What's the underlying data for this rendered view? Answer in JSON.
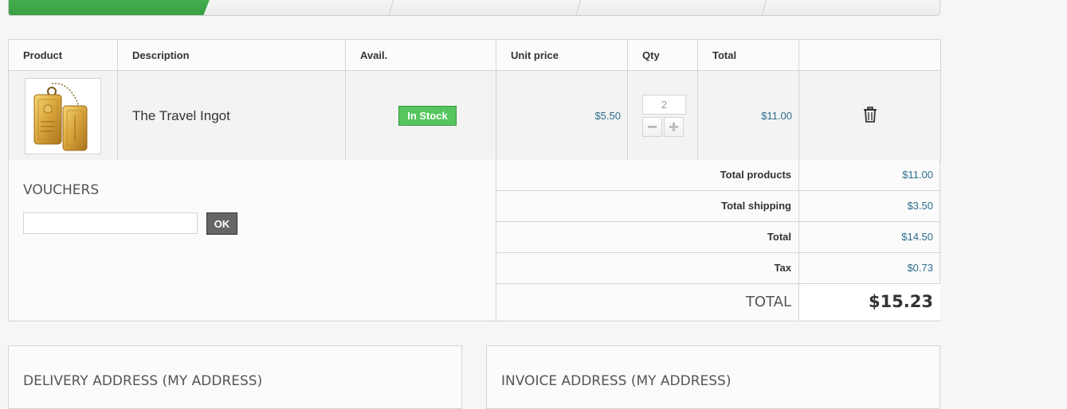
{
  "steps": {
    "active_color": "#46b34f"
  },
  "cart": {
    "headers": {
      "product": "Product",
      "description": "Description",
      "avail": "Avail.",
      "unit_price": "Unit price",
      "qty": "Qty",
      "total": "Total"
    },
    "item": {
      "name": "The Travel Ingot",
      "availability": "In Stock",
      "unit_price": "$5.50",
      "qty": "2",
      "total": "$11.00",
      "thumbnail_icon": "gold-ingot-image",
      "delete_icon": "trash-icon"
    }
  },
  "vouchers": {
    "title": "VOUCHERS",
    "input_value": "",
    "ok_label": "OK"
  },
  "totals": {
    "products_label": "Total products",
    "products_value": "$11.00",
    "shipping_label": "Total shipping",
    "shipping_value": "$3.50",
    "total_label": "Total",
    "total_value": "$14.50",
    "tax_label": "Tax",
    "tax_value": "$0.73",
    "grand_label": "TOTAL",
    "grand_value": "$15.23"
  },
  "addresses": {
    "delivery_title": "DELIVERY ADDRESS (MY ADDRESS)",
    "invoice_title": "INVOICE ADDRESS (MY ADDRESS)"
  },
  "colors": {
    "accent_green": "#55c65e",
    "price_blue": "#2d6e8e",
    "border": "#d6d4d4"
  }
}
